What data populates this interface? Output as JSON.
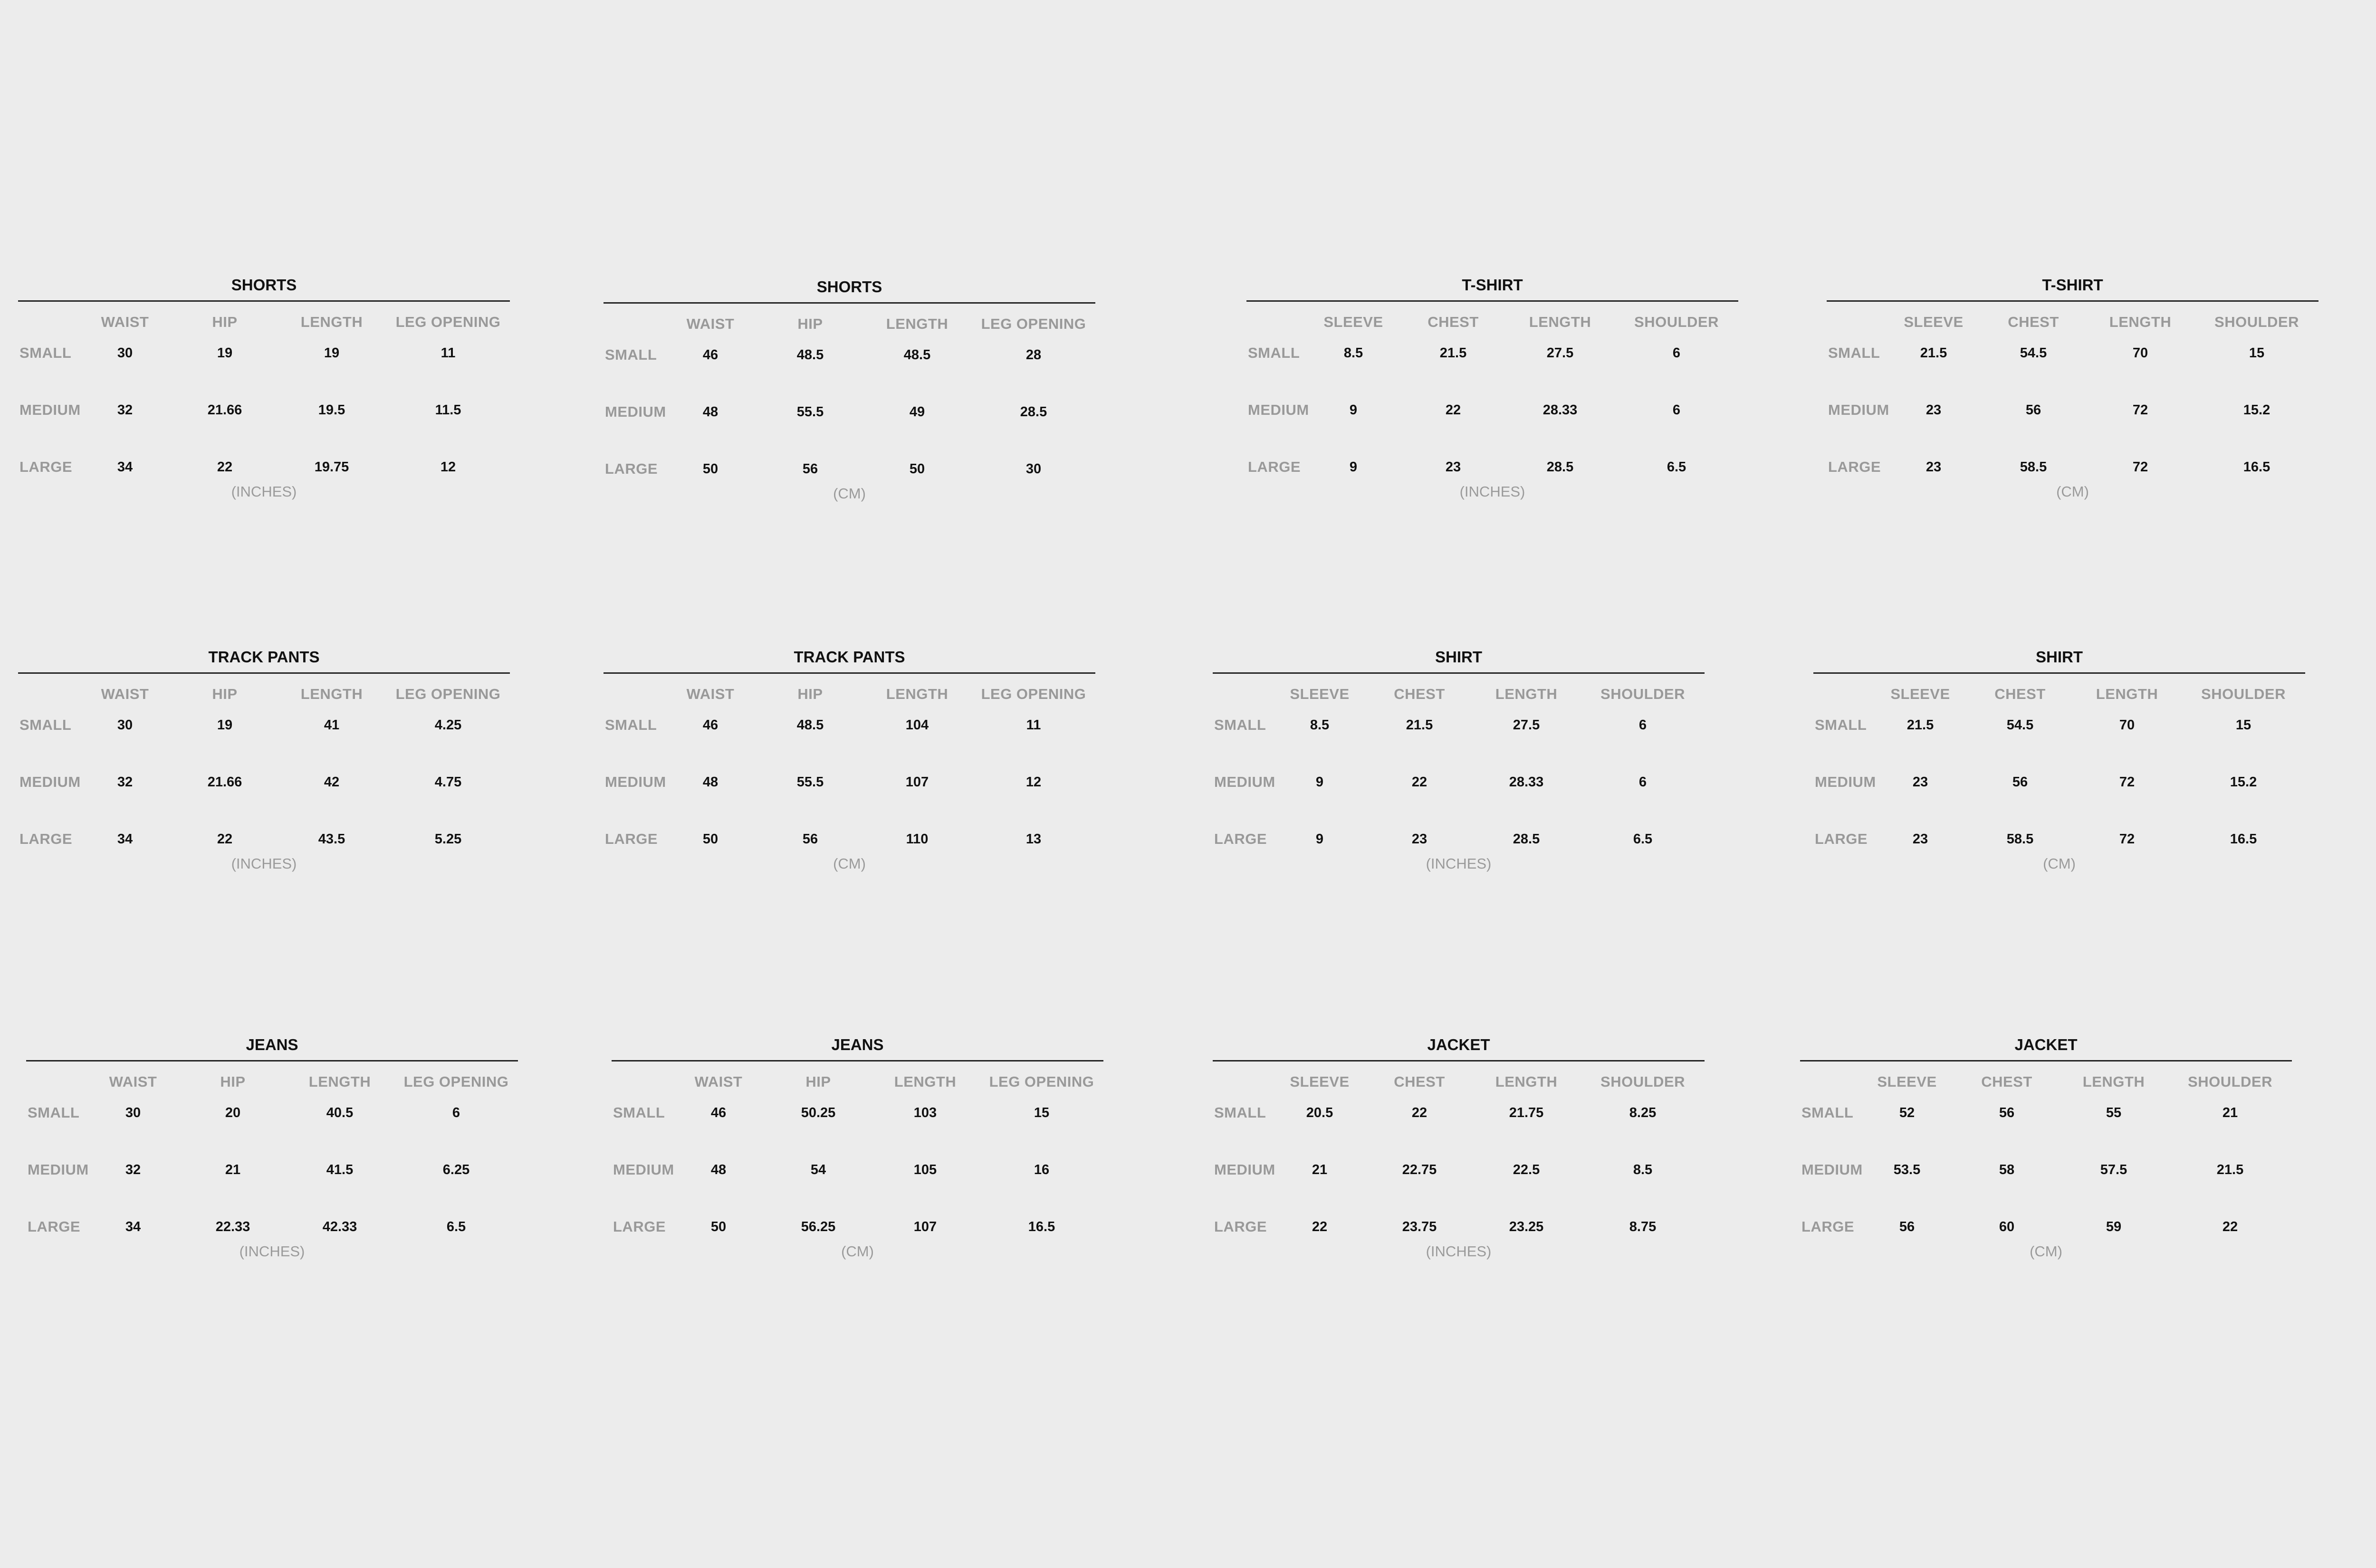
{
  "charts": [
    {
      "title": "SHORTS",
      "unit": "(INCHES)",
      "columns": [
        "WAIST",
        "HIP",
        "LENGTH",
        "LEG OPENING"
      ],
      "rows": [
        {
          "label": "SMALL",
          "values": [
            "30",
            "19",
            "19",
            "11"
          ]
        },
        {
          "label": "MEDIUM",
          "values": [
            "32",
            "21.66",
            "19.5",
            "11.5"
          ]
        },
        {
          "label": "LARGE",
          "values": [
            "34",
            "22",
            "19.75",
            "12"
          ]
        }
      ]
    },
    {
      "title": "SHORTS",
      "unit": "(CM)",
      "columns": [
        "WAIST",
        "HIP",
        "LENGTH",
        "LEG OPENING"
      ],
      "rows": [
        {
          "label": "SMALL",
          "values": [
            "46",
            "48.5",
            "48.5",
            "28"
          ]
        },
        {
          "label": "MEDIUM",
          "values": [
            "48",
            "55.5",
            "49",
            "28.5"
          ]
        },
        {
          "label": "LARGE",
          "values": [
            "50",
            "56",
            "50",
            "30"
          ]
        }
      ]
    },
    {
      "title": "T-SHIRT",
      "unit": "(INCHES)",
      "columns": [
        "SLEEVE",
        "CHEST",
        "LENGTH",
        "SHOULDER"
      ],
      "rows": [
        {
          "label": "SMALL",
          "values": [
            "8.5",
            "21.5",
            "27.5",
            "6"
          ]
        },
        {
          "label": "MEDIUM",
          "values": [
            "9",
            "22",
            "28.33",
            "6"
          ]
        },
        {
          "label": "LARGE",
          "values": [
            "9",
            "23",
            "28.5",
            "6.5"
          ]
        }
      ]
    },
    {
      "title": "T-SHIRT",
      "unit": "(CM)",
      "columns": [
        "SLEEVE",
        "CHEST",
        "LENGTH",
        "SHOULDER"
      ],
      "rows": [
        {
          "label": "SMALL",
          "values": [
            "21.5",
            "54.5",
            "70",
            "15"
          ]
        },
        {
          "label": "MEDIUM",
          "values": [
            "23",
            "56",
            "72",
            "15.2"
          ]
        },
        {
          "label": "LARGE",
          "values": [
            "23",
            "58.5",
            "72",
            "16.5"
          ]
        }
      ]
    },
    {
      "title": "TRACK PANTS",
      "unit": "(INCHES)",
      "columns": [
        "WAIST",
        "HIP",
        "LENGTH",
        "LEG OPENING"
      ],
      "rows": [
        {
          "label": "SMALL",
          "values": [
            "30",
            "19",
            "41",
            "4.25"
          ]
        },
        {
          "label": "MEDIUM",
          "values": [
            "32",
            "21.66",
            "42",
            "4.75"
          ]
        },
        {
          "label": "LARGE",
          "values": [
            "34",
            "22",
            "43.5",
            "5.25"
          ]
        }
      ]
    },
    {
      "title": "TRACK PANTS",
      "unit": "(CM)",
      "columns": [
        "WAIST",
        "HIP",
        "LENGTH",
        "LEG OPENING"
      ],
      "rows": [
        {
          "label": "SMALL",
          "values": [
            "46",
            "48.5",
            "104",
            "11"
          ]
        },
        {
          "label": "MEDIUM",
          "values": [
            "48",
            "55.5",
            "107",
            "12"
          ]
        },
        {
          "label": "LARGE",
          "values": [
            "50",
            "56",
            "110",
            "13"
          ]
        }
      ]
    },
    {
      "title": "SHIRT",
      "unit": "(INCHES)",
      "columns": [
        "SLEEVE",
        "CHEST",
        "LENGTH",
        "SHOULDER"
      ],
      "rows": [
        {
          "label": "SMALL",
          "values": [
            "8.5",
            "21.5",
            "27.5",
            "6"
          ]
        },
        {
          "label": "MEDIUM",
          "values": [
            "9",
            "22",
            "28.33",
            "6"
          ]
        },
        {
          "label": "LARGE",
          "values": [
            "9",
            "23",
            "28.5",
            "6.5"
          ]
        }
      ]
    },
    {
      "title": "SHIRT",
      "unit": "(CM)",
      "columns": [
        "SLEEVE",
        "CHEST",
        "LENGTH",
        "SHOULDER"
      ],
      "rows": [
        {
          "label": "SMALL",
          "values": [
            "21.5",
            "54.5",
            "70",
            "15"
          ]
        },
        {
          "label": "MEDIUM",
          "values": [
            "23",
            "56",
            "72",
            "15.2"
          ]
        },
        {
          "label": "LARGE",
          "values": [
            "23",
            "58.5",
            "72",
            "16.5"
          ]
        }
      ]
    },
    {
      "title": "JEANS",
      "unit": "(INCHES)",
      "columns": [
        "WAIST",
        "HIP",
        "LENGTH",
        "LEG OPENING"
      ],
      "rows": [
        {
          "label": "SMALL",
          "values": [
            "30",
            "20",
            "40.5",
            "6"
          ]
        },
        {
          "label": "MEDIUM",
          "values": [
            "32",
            "21",
            "41.5",
            "6.25"
          ]
        },
        {
          "label": "LARGE",
          "values": [
            "34",
            "22.33",
            "42.33",
            "6.5"
          ]
        }
      ]
    },
    {
      "title": "JEANS",
      "unit": "(CM)",
      "columns": [
        "WAIST",
        "HIP",
        "LENGTH",
        "LEG OPENING"
      ],
      "rows": [
        {
          "label": "SMALL",
          "values": [
            "46",
            "50.25",
            "103",
            "15"
          ]
        },
        {
          "label": "MEDIUM",
          "values": [
            "48",
            "54",
            "105",
            "16"
          ]
        },
        {
          "label": "LARGE",
          "values": [
            "50",
            "56.25",
            "107",
            "16.5"
          ]
        }
      ]
    },
    {
      "title": "JACKET",
      "unit": "(INCHES)",
      "columns": [
        "SLEEVE",
        "CHEST",
        "LENGTH",
        "SHOULDER"
      ],
      "rows": [
        {
          "label": "SMALL",
          "values": [
            "20.5",
            "22",
            "21.75",
            "8.25"
          ]
        },
        {
          "label": "MEDIUM",
          "values": [
            "21",
            "22.75",
            "22.5",
            "8.5"
          ]
        },
        {
          "label": "LARGE",
          "values": [
            "22",
            "23.75",
            "23.25",
            "8.75"
          ]
        }
      ]
    },
    {
      "title": "JACKET",
      "unit": "(CM)",
      "columns": [
        "SLEEVE",
        "CHEST",
        "LENGTH",
        "SHOULDER"
      ],
      "rows": [
        {
          "label": "SMALL",
          "values": [
            "52",
            "56",
            "55",
            "21"
          ]
        },
        {
          "label": "MEDIUM",
          "values": [
            "53.5",
            "58",
            "57.5",
            "21.5"
          ]
        },
        {
          "label": "LARGE",
          "values": [
            "56",
            "60",
            "59",
            "22"
          ]
        }
      ]
    }
  ]
}
